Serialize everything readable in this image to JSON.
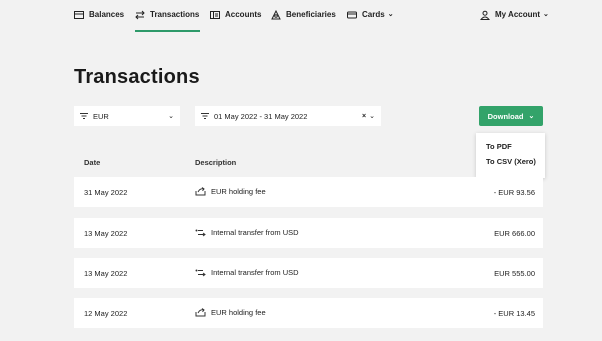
{
  "nav": {
    "balances": "Balances",
    "transactions": "Transactions",
    "accounts": "Accounts",
    "beneficiaries": "Beneficiaries",
    "cards": "Cards",
    "my_account": "My Account"
  },
  "page_title": "Transactions",
  "filters": {
    "currency": "EUR",
    "date_range": "01 May 2022 - 31 May 2022",
    "clear": "×"
  },
  "download": {
    "label": "Download",
    "options": [
      "To PDF",
      "To CSV (Xero)"
    ]
  },
  "table": {
    "headers": {
      "date": "Date",
      "description": "Description"
    },
    "rows": [
      {
        "date": "31 May 2022",
        "description": "EUR holding fee",
        "amount": "- EUR 93.56",
        "icon": "holding-fee-icon"
      },
      {
        "date": "13 May 2022",
        "description": "Internal transfer from USD",
        "amount": "EUR 666.00",
        "icon": "transfer-icon"
      },
      {
        "date": "13 May 2022",
        "description": "Internal transfer from USD",
        "amount": "EUR 555.00",
        "icon": "transfer-icon"
      },
      {
        "date": "12 May 2022",
        "description": "EUR holding fee",
        "amount": "- EUR 13.45",
        "icon": "holding-fee-icon"
      }
    ]
  },
  "colors": {
    "accent": "#33a36a",
    "background": "#f2f2f2"
  }
}
